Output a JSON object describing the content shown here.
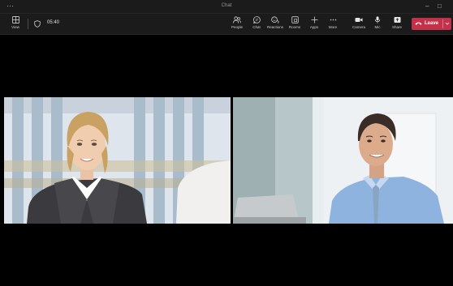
{
  "window": {
    "title": "Chat",
    "more_glyph": "···",
    "minimize_glyph": "–",
    "maximize_glyph": "□"
  },
  "toolbar": {
    "view": {
      "label": "View",
      "icon": "grid-view-icon"
    },
    "shield_icon": "shield-icon",
    "timer": "05:40",
    "buttons": [
      {
        "id": "people",
        "label": "People",
        "icon": "people-icon"
      },
      {
        "id": "chat",
        "label": "Chat",
        "icon": "chat-icon"
      },
      {
        "id": "reactions",
        "label": "Reactions",
        "icon": "reactions-icon"
      },
      {
        "id": "rooms",
        "label": "Rooms",
        "icon": "rooms-icon"
      },
      {
        "id": "apps",
        "label": "Apps",
        "icon": "plus-icon"
      },
      {
        "id": "more",
        "label": "More",
        "icon": "more-icon"
      },
      {
        "id": "camera",
        "label": "Camera",
        "icon": "camera-icon"
      },
      {
        "id": "mic",
        "label": "Mic",
        "icon": "mic-icon"
      },
      {
        "id": "share",
        "label": "Share",
        "icon": "share-icon"
      }
    ],
    "leave": {
      "label": "Leave",
      "icon": "phone-hangup-icon",
      "dropdown_icon": "chevron-down-icon"
    }
  },
  "participants": [
    {
      "position": "left",
      "kind": "video-feed"
    },
    {
      "position": "right",
      "kind": "video-feed"
    }
  ],
  "colors": {
    "background": "#000000",
    "toolbar": "#1b1b1b",
    "leave": "#c4314b"
  }
}
